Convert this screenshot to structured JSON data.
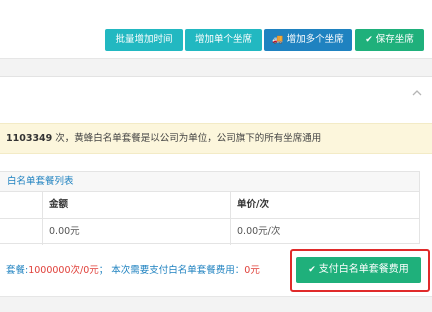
{
  "toolbar": {
    "batch_add_time": "批量增加时间",
    "add_single_seat": "增加单个坐席",
    "add_multiple_seats": "增加多个坐席",
    "save_seats": "保存坐席",
    "truck_icon": "🚚",
    "check_icon": "✔"
  },
  "notice": {
    "count": "1103349",
    "text": " 次，黄蜂白名单套餐是以公司为单位，公司旗下的所有坐席通用"
  },
  "table": {
    "title": "白名单套餐列表",
    "columns": [
      "金额",
      "单价/次"
    ],
    "rows": [
      [
        "0.00元",
        "0.00元/次"
      ]
    ]
  },
  "summary": {
    "prefix": "套餐:",
    "count_value": "1000000次/0元",
    "middle": "； 本次需要支付白名单套餐费用：",
    "total_value": "0元"
  },
  "pay_button": {
    "icon": "✔",
    "label": "支付白名单套餐费用"
  },
  "colors": {
    "teal": "#22b8c1",
    "blue": "#1f82c0",
    "green": "#1fb07b",
    "highlight_red": "#e02a2a",
    "notice_bg": "#fcf6dc"
  }
}
